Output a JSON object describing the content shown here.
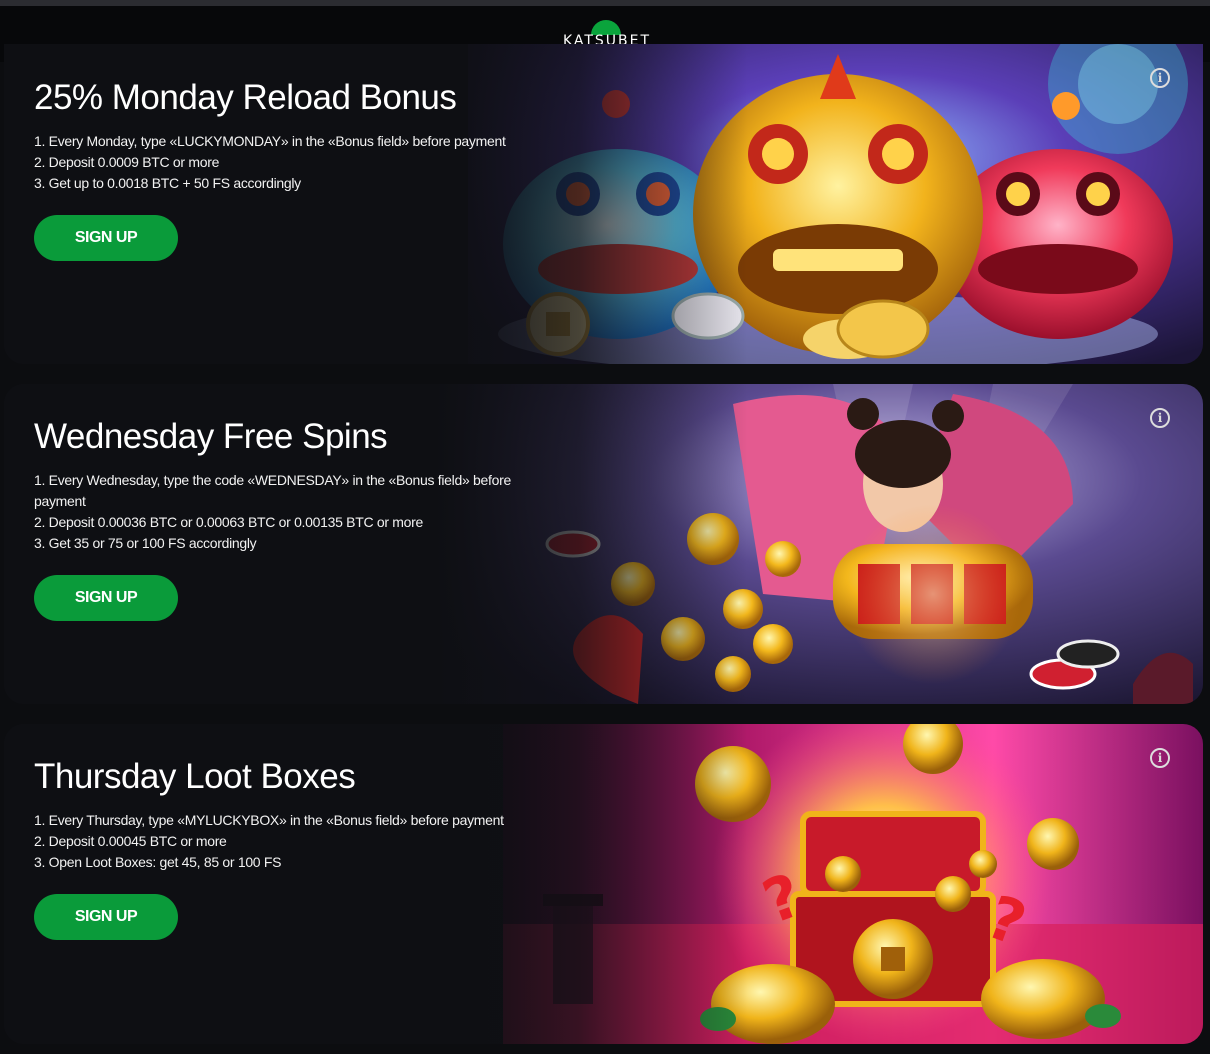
{
  "header": {
    "logo_text": "KATSUBET"
  },
  "promos": [
    {
      "title": "25% Monday Reload Bonus",
      "steps": [
        "1. Every Monday, type «LUCKYMONDAY» in the «Bonus field» before payment",
        "2. Deposit 0.0009 BTC or more",
        "3. Get up to 0.0018 BTC + 50 FS accordingly"
      ],
      "button_label": "SIGN UP",
      "info_icon": "info-icon",
      "artwork": "three lion dance heads (blue, gold, red) with coins"
    },
    {
      "title": "Wednesday Free Spins",
      "steps": [
        "1. Every Wednesday, type the code «WEDNESDAY» in the «Bonus field» before payment",
        "2. Deposit 0.00036 BTC or 0.00063 BTC or 0.00135 BTC or more",
        "3. Get 35 or 75 or 100 FS accordingly"
      ],
      "button_label": "SIGN UP",
      "info_icon": "info-icon",
      "artwork": "girl with slot reels, gold coins and poker chips"
    },
    {
      "title": "Thursday Loot Boxes",
      "steps": [
        "1. Every Thursday, type «MYLUCKYBOX» in the «Bonus field» before payment",
        "2. Deposit 0.00045 BTC or more",
        "3. Open Loot Boxes: get 45, 85 or 100 FS"
      ],
      "button_label": "SIGN UP",
      "info_icon": "info-icon",
      "artwork": "red treasure chest with gold coins and golden turtles"
    }
  ],
  "colors": {
    "accent": "#0a9b3a",
    "background": "#0c0d10",
    "header": "#07080a"
  }
}
